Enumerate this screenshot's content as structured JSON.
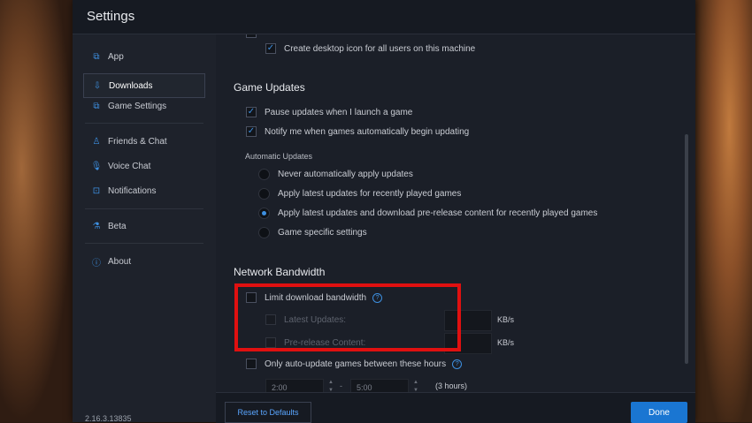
{
  "window": {
    "title": "Settings"
  },
  "sidebar": {
    "items": [
      {
        "label": "App",
        "icon": "app-icon"
      },
      {
        "label": "Downloads",
        "icon": "download-icon"
      },
      {
        "label": "Game Settings",
        "icon": "game-settings-icon"
      },
      {
        "label": "Friends & Chat",
        "icon": "friends-icon"
      },
      {
        "label": "Voice Chat",
        "icon": "microphone-icon"
      },
      {
        "label": "Notifications",
        "icon": "notifications-icon"
      },
      {
        "label": "Beta",
        "icon": "beta-icon"
      },
      {
        "label": "About",
        "icon": "info-icon"
      }
    ],
    "version": "2.16.3.13835"
  },
  "content": {
    "top_option": {
      "label": "Create desktop icon for all users on this machine",
      "checked": true
    },
    "game_updates": {
      "title": "Game Updates",
      "options": [
        {
          "label": "Pause updates when I launch a game",
          "checked": true
        },
        {
          "label": "Notify me when games automatically begin updating",
          "checked": true
        }
      ],
      "automatic_updates": {
        "title": "Automatic Updates",
        "options": [
          {
            "label": "Never automatically apply updates",
            "selected": false
          },
          {
            "label": "Apply latest updates for recently played games",
            "selected": false
          },
          {
            "label": "Apply latest updates and download pre-release content for recently played games",
            "selected": true
          },
          {
            "label": "Game specific settings",
            "selected": false
          }
        ]
      }
    },
    "network": {
      "title": "Network Bandwidth",
      "limit_label": "Limit download bandwidth",
      "latest_updates_label": "Latest Updates:",
      "prerelease_label": "Pre-release Content:",
      "unit": "KB/s",
      "auto_update_label": "Only auto-update games between these hours",
      "start_time": "2:00",
      "dash": "-",
      "end_time": "5:00",
      "duration": "(3 hours)"
    }
  },
  "footer": {
    "reset_label": "Reset to Defaults",
    "done_label": "Done"
  },
  "colors": {
    "accent": "#3d8fe0",
    "highlight": "#e01010",
    "done_button": "#1a76d2"
  }
}
